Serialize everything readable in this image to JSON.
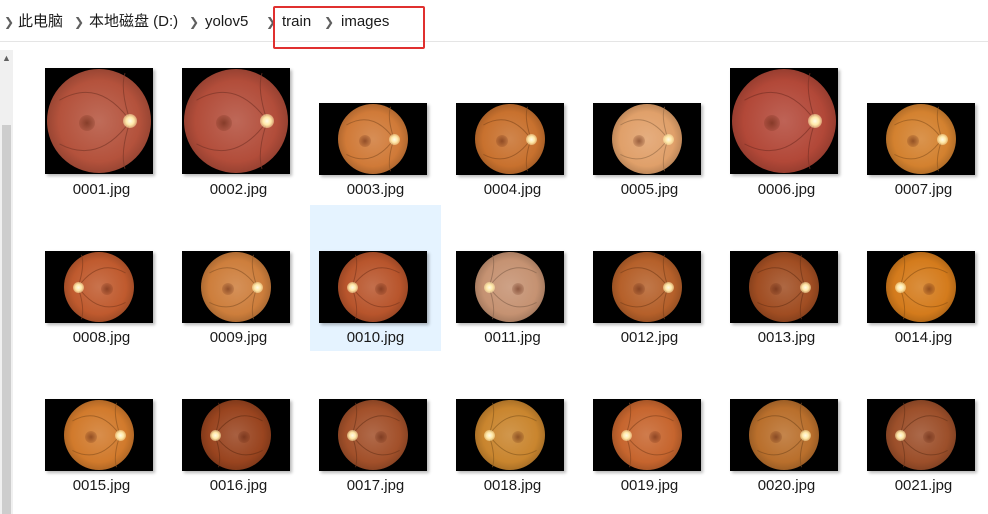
{
  "breadcrumb": {
    "items": [
      "此电脑",
      "本地磁盘 (D:)",
      "yolov5",
      "train",
      "images"
    ]
  },
  "colors": {
    "highlight": "#e0302f",
    "selection": "#e5f3ff"
  },
  "files": [
    {
      "name": "0001.jpg",
      "tone": "#b4523c"
    },
    {
      "name": "0002.jpg",
      "tone": "#b24d3a"
    },
    {
      "name": "0003.jpg",
      "tone": "#d07a38"
    },
    {
      "name": "0004.jpg",
      "tone": "#c8712e"
    },
    {
      "name": "0005.jpg",
      "tone": "#e0a06a"
    },
    {
      "name": "0006.jpg",
      "tone": "#b24838"
    },
    {
      "name": "0007.jpg",
      "tone": "#d3812f"
    },
    {
      "name": "0008.jpg",
      "tone": "#bf5a2e"
    },
    {
      "name": "0009.jpg",
      "tone": "#cd7e3c"
    },
    {
      "name": "0010.jpg",
      "tone": "#b8552c"
    },
    {
      "name": "0011.jpg",
      "tone": "#c59272"
    },
    {
      "name": "0012.jpg",
      "tone": "#b5602a"
    },
    {
      "name": "0013.jpg",
      "tone": "#a04d22"
    },
    {
      "name": "0014.jpg",
      "tone": "#d47b1c"
    },
    {
      "name": "0015.jpg",
      "tone": "#d17a2c"
    },
    {
      "name": "0016.jpg",
      "tone": "#99441f"
    },
    {
      "name": "0017.jpg",
      "tone": "#a2502a"
    },
    {
      "name": "0018.jpg",
      "tone": "#c9852e"
    },
    {
      "name": "0019.jpg",
      "tone": "#c6652e"
    },
    {
      "name": "0020.jpg",
      "tone": "#b96f2c"
    },
    {
      "name": "0021.jpg",
      "tone": "#9c4f2a"
    }
  ],
  "selected_file": "0010.jpg"
}
